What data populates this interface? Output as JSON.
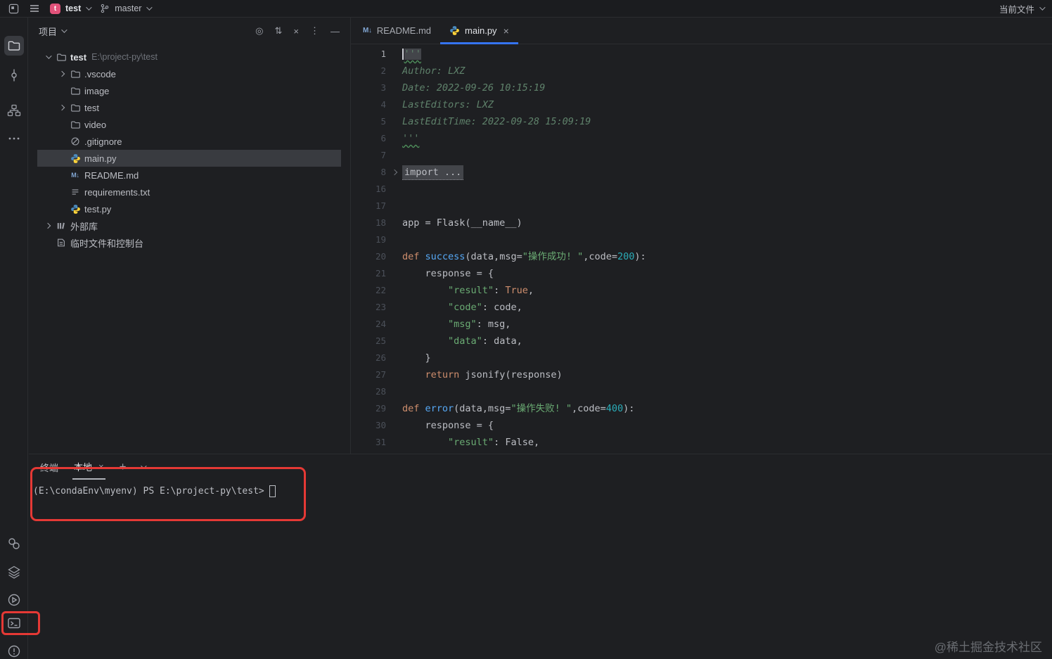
{
  "topbar": {
    "project_name": "test",
    "project_initial": "t",
    "branch_name": "master",
    "run_widget_label": "当前文件"
  },
  "tool_strip": {
    "top_icons": [
      "project",
      "commit",
      "structure",
      "more"
    ],
    "bottom_icons": [
      "python-packages",
      "services",
      "run",
      "terminal",
      "problems"
    ]
  },
  "project_panel": {
    "title": "项目",
    "header_icons": [
      "locate",
      "expand",
      "collapse",
      "more",
      "hide"
    ],
    "tree": [
      {
        "label": "test",
        "path": "E:\\project-py\\test",
        "indent": 0,
        "chevron": "down",
        "icon": "folder",
        "bold": true
      },
      {
        "label": ".vscode",
        "indent": 1,
        "chevron": "right",
        "icon": "folder"
      },
      {
        "label": "image",
        "indent": 1,
        "icon": "folder"
      },
      {
        "label": "test",
        "indent": 1,
        "chevron": "right",
        "icon": "folder"
      },
      {
        "label": "video",
        "indent": 1,
        "icon": "folder"
      },
      {
        "label": ".gitignore",
        "indent": 1,
        "icon": "gitignore"
      },
      {
        "label": "main.py",
        "indent": 1,
        "icon": "python",
        "selected": true
      },
      {
        "label": "README.md",
        "indent": 1,
        "icon": "markdown"
      },
      {
        "label": "requirements.txt",
        "indent": 1,
        "icon": "text"
      },
      {
        "label": "test.py",
        "indent": 1,
        "icon": "python"
      },
      {
        "label": "外部库",
        "indent": 0,
        "chevron": "right",
        "icon": "library"
      },
      {
        "label": "临时文件和控制台",
        "indent": 0,
        "icon": "scratch"
      }
    ]
  },
  "editor": {
    "tabs": [
      {
        "label": "README.md",
        "icon": "markdown"
      },
      {
        "label": "main.py",
        "icon": "python",
        "active": true,
        "close": "×"
      }
    ],
    "lines": [
      {
        "n": 1,
        "active": true,
        "caret": true,
        "tokens": [
          {
            "t": "'''",
            "c": "doc",
            "u": "wavy",
            "hl": true
          }
        ]
      },
      {
        "n": 2,
        "tokens": [
          {
            "t": "Author: LXZ",
            "c": "doc"
          }
        ]
      },
      {
        "n": 3,
        "tokens": [
          {
            "t": "Date: 2022-09-26 10:15:19",
            "c": "doc"
          }
        ]
      },
      {
        "n": 4,
        "tokens": [
          {
            "t": "LastEditors: LXZ",
            "c": "doc"
          }
        ]
      },
      {
        "n": 5,
        "tokens": [
          {
            "t": "LastEditTime: 2022-09-28 15:09:19",
            "c": "doc"
          }
        ]
      },
      {
        "n": 6,
        "tokens": [
          {
            "t": "'''",
            "c": "doc",
            "u": "wavy"
          }
        ]
      },
      {
        "n": 7,
        "tokens": []
      },
      {
        "n": 8,
        "fold": true,
        "tokens": [
          {
            "t": "import ...",
            "c": "fold"
          }
        ]
      },
      {
        "n": 16,
        "tokens": []
      },
      {
        "n": 17,
        "tokens": []
      },
      {
        "n": 18,
        "tokens": [
          {
            "t": "app = Flask(__name__)",
            "c": "plain"
          }
        ]
      },
      {
        "n": 19,
        "tokens": []
      },
      {
        "n": 20,
        "tokens": [
          {
            "t": "def ",
            "c": "kw"
          },
          {
            "t": "success",
            "c": "fn"
          },
          {
            "t": "(data,msg=",
            "c": "plain"
          },
          {
            "t": "\"操作成功! \"",
            "c": "str"
          },
          {
            "t": ",code=",
            "c": "plain"
          },
          {
            "t": "200",
            "c": "num"
          },
          {
            "t": "):",
            "c": "plain"
          }
        ]
      },
      {
        "n": 21,
        "tokens": [
          {
            "t": "    response = {",
            "c": "plain"
          }
        ]
      },
      {
        "n": 22,
        "tokens": [
          {
            "t": "        ",
            "c": "plain"
          },
          {
            "t": "\"result\"",
            "c": "str"
          },
          {
            "t": ": ",
            "c": "plain"
          },
          {
            "t": "True",
            "c": "kw"
          },
          {
            "t": ",",
            "c": "plain"
          }
        ]
      },
      {
        "n": 23,
        "tokens": [
          {
            "t": "        ",
            "c": "plain"
          },
          {
            "t": "\"code\"",
            "c": "str"
          },
          {
            "t": ": code,",
            "c": "plain"
          }
        ]
      },
      {
        "n": 24,
        "tokens": [
          {
            "t": "        ",
            "c": "plain"
          },
          {
            "t": "\"msg\"",
            "c": "str"
          },
          {
            "t": ": msg,",
            "c": "plain"
          }
        ]
      },
      {
        "n": 25,
        "tokens": [
          {
            "t": "        ",
            "c": "plain"
          },
          {
            "t": "\"data\"",
            "c": "str"
          },
          {
            "t": ": data,",
            "c": "plain"
          }
        ]
      },
      {
        "n": 26,
        "tokens": [
          {
            "t": "    }",
            "c": "plain"
          }
        ]
      },
      {
        "n": 27,
        "tokens": [
          {
            "t": "    ",
            "c": "plain"
          },
          {
            "t": "return",
            "c": "kw"
          },
          {
            "t": " jsonify(response)",
            "c": "plain"
          }
        ]
      },
      {
        "n": 28,
        "tokens": []
      },
      {
        "n": 29,
        "tokens": [
          {
            "t": "def ",
            "c": "kw"
          },
          {
            "t": "error",
            "c": "fn"
          },
          {
            "t": "(data,msg=",
            "c": "plain"
          },
          {
            "t": "\"操作失败! \"",
            "c": "str"
          },
          {
            "t": ",code=",
            "c": "plain"
          },
          {
            "t": "400",
            "c": "num"
          },
          {
            "t": "):",
            "c": "plain"
          }
        ]
      },
      {
        "n": 30,
        "tokens": [
          {
            "t": "    response = {",
            "c": "plain"
          }
        ]
      },
      {
        "n": 31,
        "tokens": [
          {
            "t": "        ",
            "c": "plain"
          },
          {
            "t": "\"result\"",
            "c": "str"
          },
          {
            "t": ": False,",
            "c": "plain"
          }
        ]
      }
    ]
  },
  "terminal": {
    "title": "终端",
    "tab_label": "本地",
    "tab_close": "×",
    "new_tab": "+",
    "prompt": "(E:\\condaEnv\\myenv) PS E:\\project-py\\test>"
  },
  "watermark": "@稀土掘金技术社区",
  "colors": {
    "background": "#1E1F22",
    "panel_divider": "#2B2D30",
    "selection": "#393B40",
    "accent_blue": "#3574F0",
    "annotation_red": "#E53935",
    "keyword": "#CF8E6D",
    "string": "#6AAB73",
    "number": "#2AACB8",
    "comment": "#5F826B",
    "function": "#56A8F5"
  }
}
